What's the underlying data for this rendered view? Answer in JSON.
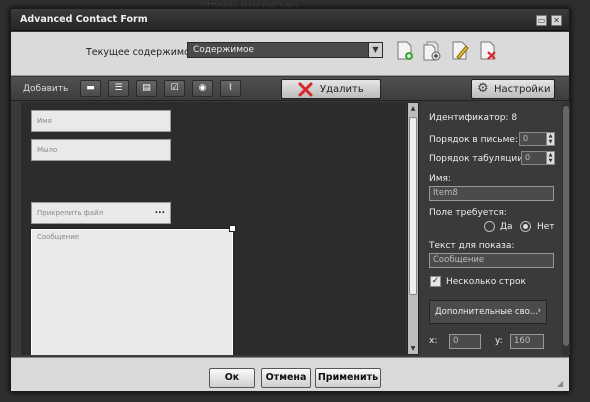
{
  "window": {
    "title": "Advanced Contact Form"
  },
  "header": {
    "content_label": "Текущее содержимое:",
    "content_value": "Содержимое",
    "icons": [
      "new-page-icon",
      "add-page-icon",
      "edit-page-icon",
      "delete-page-icon"
    ]
  },
  "toolbar": {
    "add_label": "Добавить",
    "tools": [
      "textfield-icon",
      "textarea-icon",
      "dropdown-icon",
      "checkbox-icon",
      "radio-icon",
      "attachment-icon"
    ],
    "delete_label": "Удалить",
    "settings_label": "Настройки"
  },
  "canvas": {
    "field_name": "Имя",
    "field_email": "Мыло",
    "field_attach": "Прикрепить файл",
    "field_attach_btn": "...",
    "field_message": "Сообщение"
  },
  "props": {
    "identifier": "Идентификатор: 8",
    "order_mail_label": "Порядок в письме:",
    "order_mail_value": "0",
    "order_tab_label": "Порядок табуляции:",
    "order_tab_value": "0",
    "name_label": "Имя:",
    "name_value": "Item8",
    "required_label": "Поле требуется:",
    "yes_label": "Да",
    "no_label": "Нет",
    "display_text_label": "Текст для показа:",
    "display_text_value": "Сообщение",
    "multiline_label": "Несколько строк",
    "more_props_label": "Дополнительные сво...",
    "x_label": "x:",
    "x_value": "0",
    "y_label": "y:",
    "y_value": "160"
  },
  "footer": {
    "ok_label": "Ок",
    "cancel_label": "Отмена",
    "apply_label": "Применить"
  },
  "colors": {
    "accent_red": "#d8262a",
    "panel": "#3a3a3a",
    "header_bg": "#dadada"
  }
}
